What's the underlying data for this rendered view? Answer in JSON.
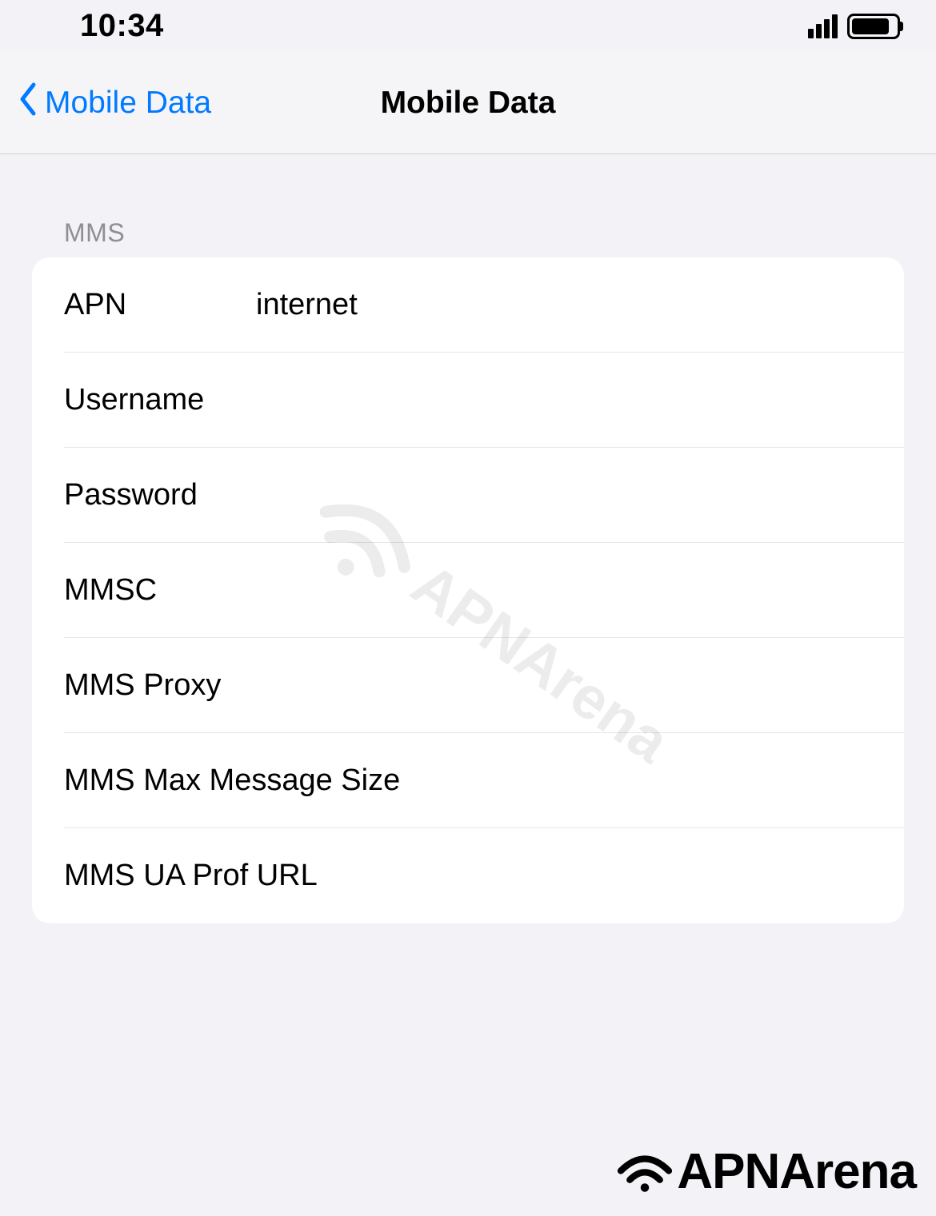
{
  "status_bar": {
    "time": "10:34"
  },
  "nav": {
    "back_label": "Mobile Data",
    "title": "Mobile Data"
  },
  "section": {
    "header": "MMS"
  },
  "rows": {
    "apn_label": "APN",
    "apn_value": "internet",
    "username_label": "Username",
    "username_value": "",
    "password_label": "Password",
    "password_value": "",
    "mmsc_label": "MMSC",
    "mmsc_value": "",
    "mms_proxy_label": "MMS Proxy",
    "mms_proxy_value": "",
    "mms_max_label": "MMS Max Message Size",
    "mms_max_value": "",
    "mms_ua_label": "MMS UA Prof URL",
    "mms_ua_value": ""
  },
  "watermark": {
    "text": "APNArena"
  }
}
